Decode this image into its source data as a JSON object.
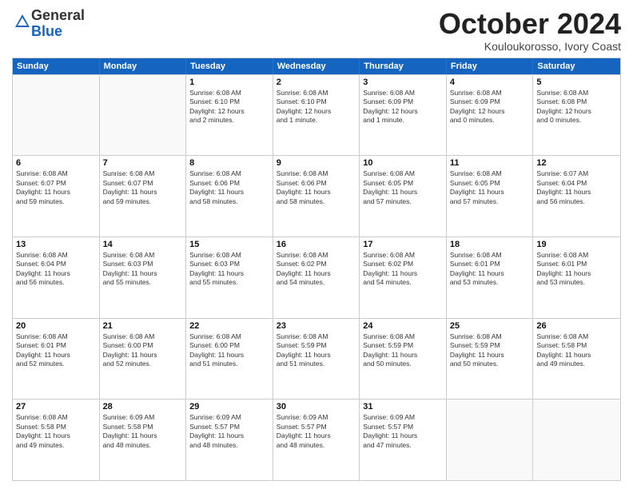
{
  "logo": {
    "general": "General",
    "blue": "Blue"
  },
  "title": "October 2024",
  "location": "Kouloukorosso, Ivory Coast",
  "days_of_week": [
    "Sunday",
    "Monday",
    "Tuesday",
    "Wednesday",
    "Thursday",
    "Friday",
    "Saturday"
  ],
  "weeks": [
    [
      {
        "day": "",
        "text": ""
      },
      {
        "day": "",
        "text": ""
      },
      {
        "day": "1",
        "text": "Sunrise: 6:08 AM\nSunset: 6:10 PM\nDaylight: 12 hours\nand 2 minutes."
      },
      {
        "day": "2",
        "text": "Sunrise: 6:08 AM\nSunset: 6:10 PM\nDaylight: 12 hours\nand 1 minute."
      },
      {
        "day": "3",
        "text": "Sunrise: 6:08 AM\nSunset: 6:09 PM\nDaylight: 12 hours\nand 1 minute."
      },
      {
        "day": "4",
        "text": "Sunrise: 6:08 AM\nSunset: 6:09 PM\nDaylight: 12 hours\nand 0 minutes."
      },
      {
        "day": "5",
        "text": "Sunrise: 6:08 AM\nSunset: 6:08 PM\nDaylight: 12 hours\nand 0 minutes."
      }
    ],
    [
      {
        "day": "6",
        "text": "Sunrise: 6:08 AM\nSunset: 6:07 PM\nDaylight: 11 hours\nand 59 minutes."
      },
      {
        "day": "7",
        "text": "Sunrise: 6:08 AM\nSunset: 6:07 PM\nDaylight: 11 hours\nand 59 minutes."
      },
      {
        "day": "8",
        "text": "Sunrise: 6:08 AM\nSunset: 6:06 PM\nDaylight: 11 hours\nand 58 minutes."
      },
      {
        "day": "9",
        "text": "Sunrise: 6:08 AM\nSunset: 6:06 PM\nDaylight: 11 hours\nand 58 minutes."
      },
      {
        "day": "10",
        "text": "Sunrise: 6:08 AM\nSunset: 6:05 PM\nDaylight: 11 hours\nand 57 minutes."
      },
      {
        "day": "11",
        "text": "Sunrise: 6:08 AM\nSunset: 6:05 PM\nDaylight: 11 hours\nand 57 minutes."
      },
      {
        "day": "12",
        "text": "Sunrise: 6:07 AM\nSunset: 6:04 PM\nDaylight: 11 hours\nand 56 minutes."
      }
    ],
    [
      {
        "day": "13",
        "text": "Sunrise: 6:08 AM\nSunset: 6:04 PM\nDaylight: 11 hours\nand 56 minutes."
      },
      {
        "day": "14",
        "text": "Sunrise: 6:08 AM\nSunset: 6:03 PM\nDaylight: 11 hours\nand 55 minutes."
      },
      {
        "day": "15",
        "text": "Sunrise: 6:08 AM\nSunset: 6:03 PM\nDaylight: 11 hours\nand 55 minutes."
      },
      {
        "day": "16",
        "text": "Sunrise: 6:08 AM\nSunset: 6:02 PM\nDaylight: 11 hours\nand 54 minutes."
      },
      {
        "day": "17",
        "text": "Sunrise: 6:08 AM\nSunset: 6:02 PM\nDaylight: 11 hours\nand 54 minutes."
      },
      {
        "day": "18",
        "text": "Sunrise: 6:08 AM\nSunset: 6:01 PM\nDaylight: 11 hours\nand 53 minutes."
      },
      {
        "day": "19",
        "text": "Sunrise: 6:08 AM\nSunset: 6:01 PM\nDaylight: 11 hours\nand 53 minutes."
      }
    ],
    [
      {
        "day": "20",
        "text": "Sunrise: 6:08 AM\nSunset: 6:01 PM\nDaylight: 11 hours\nand 52 minutes."
      },
      {
        "day": "21",
        "text": "Sunrise: 6:08 AM\nSunset: 6:00 PM\nDaylight: 11 hours\nand 52 minutes."
      },
      {
        "day": "22",
        "text": "Sunrise: 6:08 AM\nSunset: 6:00 PM\nDaylight: 11 hours\nand 51 minutes."
      },
      {
        "day": "23",
        "text": "Sunrise: 6:08 AM\nSunset: 5:59 PM\nDaylight: 11 hours\nand 51 minutes."
      },
      {
        "day": "24",
        "text": "Sunrise: 6:08 AM\nSunset: 5:59 PM\nDaylight: 11 hours\nand 50 minutes."
      },
      {
        "day": "25",
        "text": "Sunrise: 6:08 AM\nSunset: 5:59 PM\nDaylight: 11 hours\nand 50 minutes."
      },
      {
        "day": "26",
        "text": "Sunrise: 6:08 AM\nSunset: 5:58 PM\nDaylight: 11 hours\nand 49 minutes."
      }
    ],
    [
      {
        "day": "27",
        "text": "Sunrise: 6:08 AM\nSunset: 5:58 PM\nDaylight: 11 hours\nand 49 minutes."
      },
      {
        "day": "28",
        "text": "Sunrise: 6:09 AM\nSunset: 5:58 PM\nDaylight: 11 hours\nand 48 minutes."
      },
      {
        "day": "29",
        "text": "Sunrise: 6:09 AM\nSunset: 5:57 PM\nDaylight: 11 hours\nand 48 minutes."
      },
      {
        "day": "30",
        "text": "Sunrise: 6:09 AM\nSunset: 5:57 PM\nDaylight: 11 hours\nand 48 minutes."
      },
      {
        "day": "31",
        "text": "Sunrise: 6:09 AM\nSunset: 5:57 PM\nDaylight: 11 hours\nand 47 minutes."
      },
      {
        "day": "",
        "text": ""
      },
      {
        "day": "",
        "text": ""
      }
    ]
  ]
}
